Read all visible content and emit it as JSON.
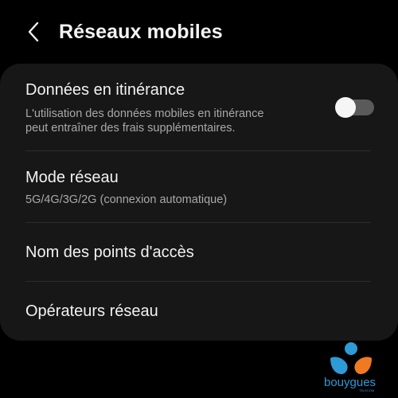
{
  "header": {
    "title": "Réseaux mobiles"
  },
  "items": [
    {
      "title": "Données en itinérance",
      "subtitle_line1": "L'utilisation des données mobiles en itinérance",
      "subtitle_line2": "peut entraîner des frais supplémentaires.",
      "toggle_on": false
    },
    {
      "title": "Mode réseau",
      "subtitle_line1": "5G/4G/3G/2G (connexion automatique)"
    },
    {
      "title": "Nom des points d'accès"
    },
    {
      "title": "Opérateurs réseau"
    }
  ],
  "brand": {
    "name": "bouygues",
    "tag": "TELECOM"
  },
  "colors": {
    "background": "#000000",
    "card": "#171717",
    "toggle_track_off": "#5a5a5a",
    "brand_blue": "#2e9ad8",
    "brand_orange": "#f07a22"
  }
}
